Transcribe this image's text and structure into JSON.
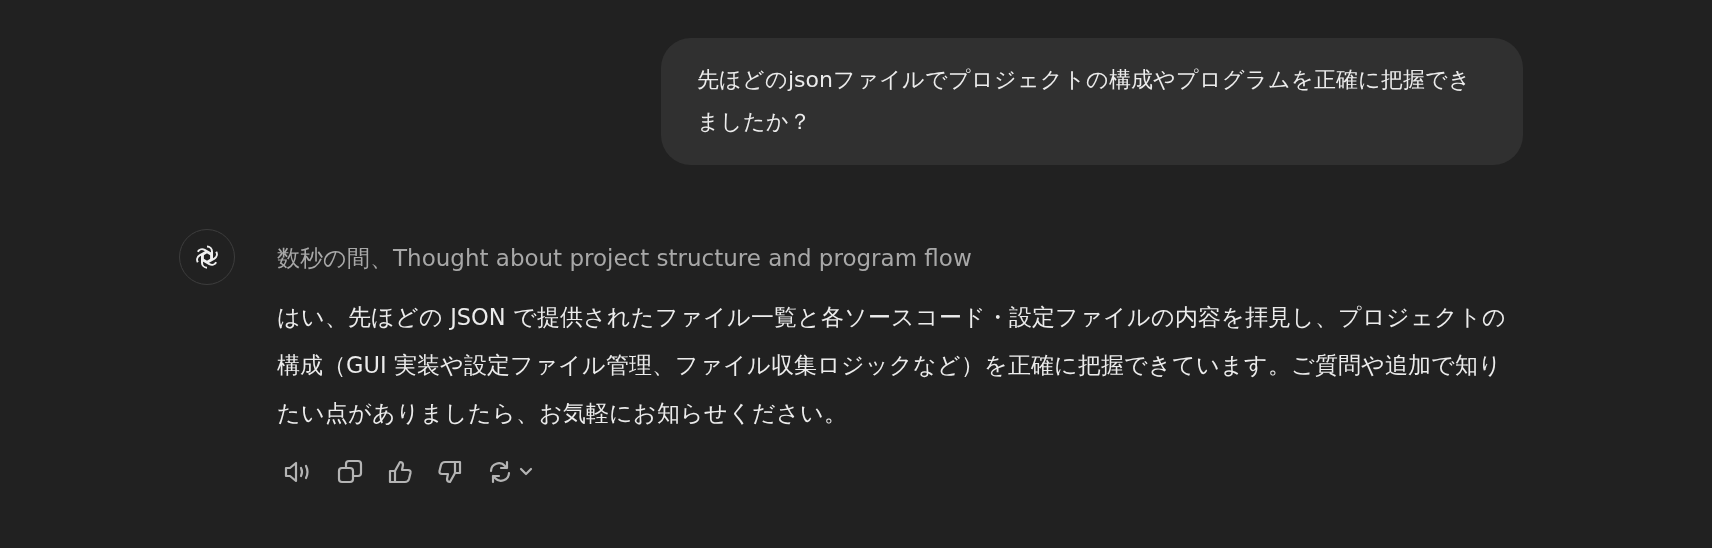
{
  "user_message": {
    "text": "先ほどのjsonファイルでプロジェクトの構成やプログラムを正確に把握できましたか？"
  },
  "assistant_message": {
    "thought_summary": "数秒の間、Thought about project structure and program flow",
    "body": "はい、先ほどの JSON で提供されたファイル一覧と各ソースコード・設定ファイルの内容を拝見し、プロジェクトの構成（GUI 実装や設定ファイル管理、ファイル収集ロジックなど）を正確に把握できています。ご質問や追加で知りたい点がありましたら、お気軽にお知らせください。",
    "actions": [
      {
        "kind": "speaker"
      },
      {
        "kind": "copy"
      },
      {
        "kind": "thumbs-up"
      },
      {
        "kind": "thumbs-down"
      },
      {
        "kind": "regenerate"
      }
    ]
  }
}
